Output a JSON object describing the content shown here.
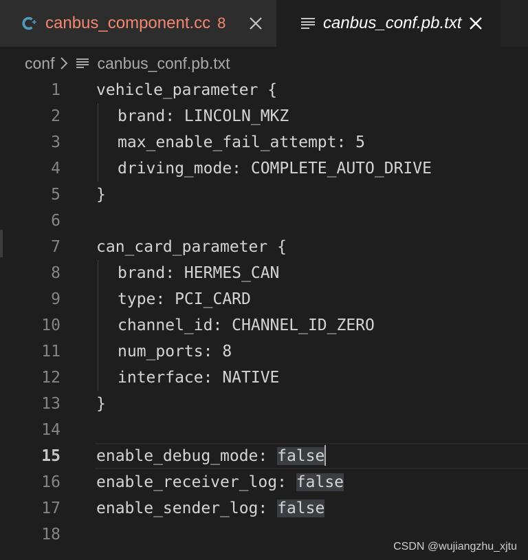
{
  "tabs": [
    {
      "icon": "cpp-file-icon",
      "name": "canbus_component.cc",
      "badge": "8",
      "active": false
    },
    {
      "icon": "text-file-icon",
      "name": "canbus_conf.pb.txt",
      "active": true
    }
  ],
  "breadcrumb": {
    "folder": "conf",
    "file": "canbus_conf.pb.txt"
  },
  "editor": {
    "current_line": 15,
    "lines": [
      {
        "n": "1",
        "text": "vehicle_parameter {"
      },
      {
        "n": "2",
        "text": "brand: LINCOLN_MKZ"
      },
      {
        "n": "3",
        "text": "max_enable_fail_attempt: 5"
      },
      {
        "n": "4",
        "text": "driving_mode: COMPLETE_AUTO_DRIVE"
      },
      {
        "n": "5",
        "text": "}"
      },
      {
        "n": "6",
        "text": ""
      },
      {
        "n": "7",
        "text": "can_card_parameter {"
      },
      {
        "n": "8",
        "text": "brand: HERMES_CAN"
      },
      {
        "n": "9",
        "text": "type: PCI_CARD"
      },
      {
        "n": "10",
        "text": "channel_id: CHANNEL_ID_ZERO"
      },
      {
        "n": "11",
        "text": "num_ports: 8"
      },
      {
        "n": "12",
        "text": "interface: NATIVE"
      },
      {
        "n": "13",
        "text": "}"
      },
      {
        "n": "14",
        "text": ""
      },
      {
        "n": "15",
        "key": "enable_debug_mode: ",
        "value": "false"
      },
      {
        "n": "16",
        "key": "enable_receiver_log: ",
        "value": "false"
      },
      {
        "n": "17",
        "key": "enable_sender_log: ",
        "value": "false"
      },
      {
        "n": "18",
        "text": ""
      }
    ]
  },
  "colors": {
    "background": "#1e1e1e",
    "tab_inactive": "#2d2d2d",
    "tab_error_text": "#f48771",
    "cpp_icon": "#519aba",
    "selection_highlight": "#3a3d41"
  },
  "watermark": "CSDN @wujiangzhu_xjtu"
}
